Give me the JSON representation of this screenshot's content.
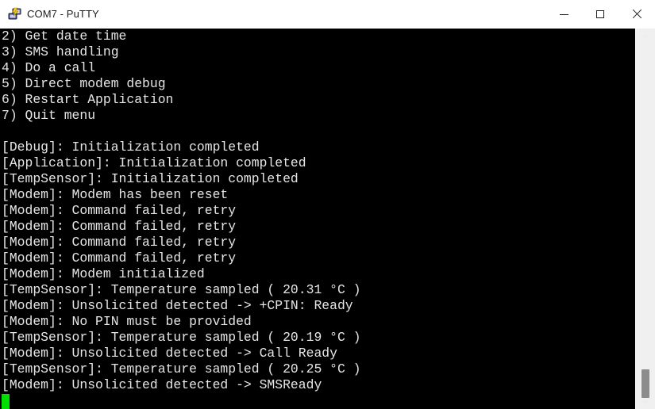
{
  "window": {
    "title": "COM7 - PuTTY",
    "icon": "putty-computer-icon",
    "controls": {
      "minimize_label": "Minimize",
      "maximize_label": "Maximize",
      "close_label": "Close"
    },
    "titlebar_bg": "#ffffff",
    "titlebar_fg": "#1b1b1b"
  },
  "terminal": {
    "background": "#000000",
    "foreground": "#e6e6e6",
    "cursor_color": "#00e000",
    "lines": [
      "2) Get date time",
      "3) SMS handling",
      "4) Do a call",
      "5) Direct modem debug",
      "6) Restart Application",
      "7) Quit menu",
      "",
      "[Debug]: Initialization completed",
      "[Application]: Initialization completed",
      "[TempSensor]: Initialization completed",
      "[Modem]: Modem has been reset",
      "[Modem]: Command failed, retry",
      "[Modem]: Command failed, retry",
      "[Modem]: Command failed, retry",
      "[Modem]: Command failed, retry",
      "[Modem]: Modem initialized",
      "[TempSensor]: Temperature sampled ( 20.31 °C )",
      "[Modem]: Unsolicited detected -> +CPIN: Ready",
      "[Modem]: No PIN must be provided",
      "[TempSensor]: Temperature sampled ( 20.19 °C )",
      "[Modem]: Unsolicited detected -> Call Ready",
      "[TempSensor]: Temperature sampled ( 20.25 °C )",
      "[Modem]: Unsolicited detected -> SMSReady"
    ]
  },
  "scrollbar": {
    "orientation": "vertical",
    "thumb_position": "near-bottom",
    "track_color": "#f0f0f0",
    "thumb_color": "#8c8c8c"
  }
}
